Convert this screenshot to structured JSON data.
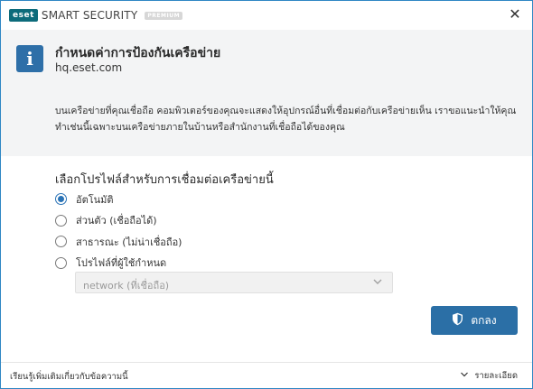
{
  "titlebar": {
    "brand_mark": "eset",
    "product": "SMART SECURITY",
    "edition": "PREMIUM",
    "close_glyph": "✕"
  },
  "info": {
    "icon": "info-icon",
    "title": "กำหนดค่าการป้องกันเครือข่าย",
    "host": "hq.eset.com",
    "description": "บนเครือข่ายที่คุณเชื่อถือ คอมพิวเตอร์ของคุณจะแสดงให้อุปกรณ์อื่นที่เชื่อมต่อกับเครือข่ายเห็น เราขอแนะนำให้คุณทำเช่นนี้เฉพาะบนเครือข่ายภายในบ้านหรือสำนักงานที่เชื่อถือได้ของคุณ"
  },
  "profile": {
    "section_title": "เลือกโปรไฟล์สำหรับการเชื่อมต่อเครือข่ายนี้",
    "options": [
      {
        "label": "อัตโนมัติ",
        "checked": true
      },
      {
        "label": "ส่วนตัว (เชื่อถือได้)",
        "checked": false
      },
      {
        "label": "สาธารณะ (ไม่น่าเชื่อถือ)",
        "checked": false
      },
      {
        "label": "โปรไฟล์ที่ผู้ใช้กำหนด",
        "checked": false
      }
    ],
    "select_value": "network (ที่เชื่อถือ)",
    "select_disabled": true
  },
  "actions": {
    "ok_label": "ตกลง"
  },
  "footer": {
    "learn_more": "เรียนรู้เพิ่มเติมเกี่ยวกับข้อความนี้",
    "details": "รายละเอียด"
  },
  "colors": {
    "accent": "#2b6fa6",
    "brand": "#0d6b7b",
    "panel_bg": "#f3f4f5"
  }
}
